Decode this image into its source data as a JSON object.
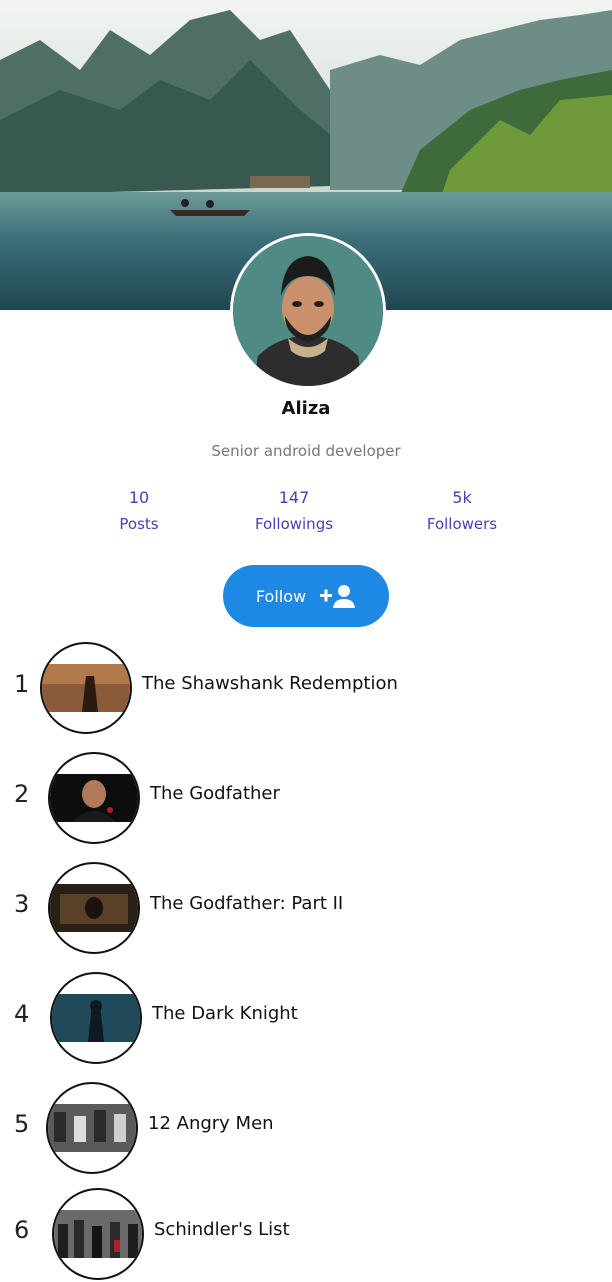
{
  "profile": {
    "name": "Aliza",
    "role": "Senior android developer"
  },
  "stats": [
    {
      "value": "10",
      "label": "Posts"
    },
    {
      "value": "147",
      "label": "Followings"
    },
    {
      "value": "5k",
      "label": "Followers"
    }
  ],
  "follow_button": {
    "label": "Follow",
    "icon": "person-add-icon"
  },
  "movies": [
    {
      "rank": "1",
      "title": "The Shawshank Redemption"
    },
    {
      "rank": "2",
      "title": "The Godfather"
    },
    {
      "rank": "3",
      "title": "The Godfather: Part II"
    },
    {
      "rank": "4",
      "title": "The Dark Knight"
    },
    {
      "rank": "5",
      "title": "12 Angry Men"
    },
    {
      "rank": "6",
      "title": "Schindler's List"
    }
  ],
  "colors": {
    "accent": "#1e88e5",
    "stat_text": "#4a3fb4"
  }
}
